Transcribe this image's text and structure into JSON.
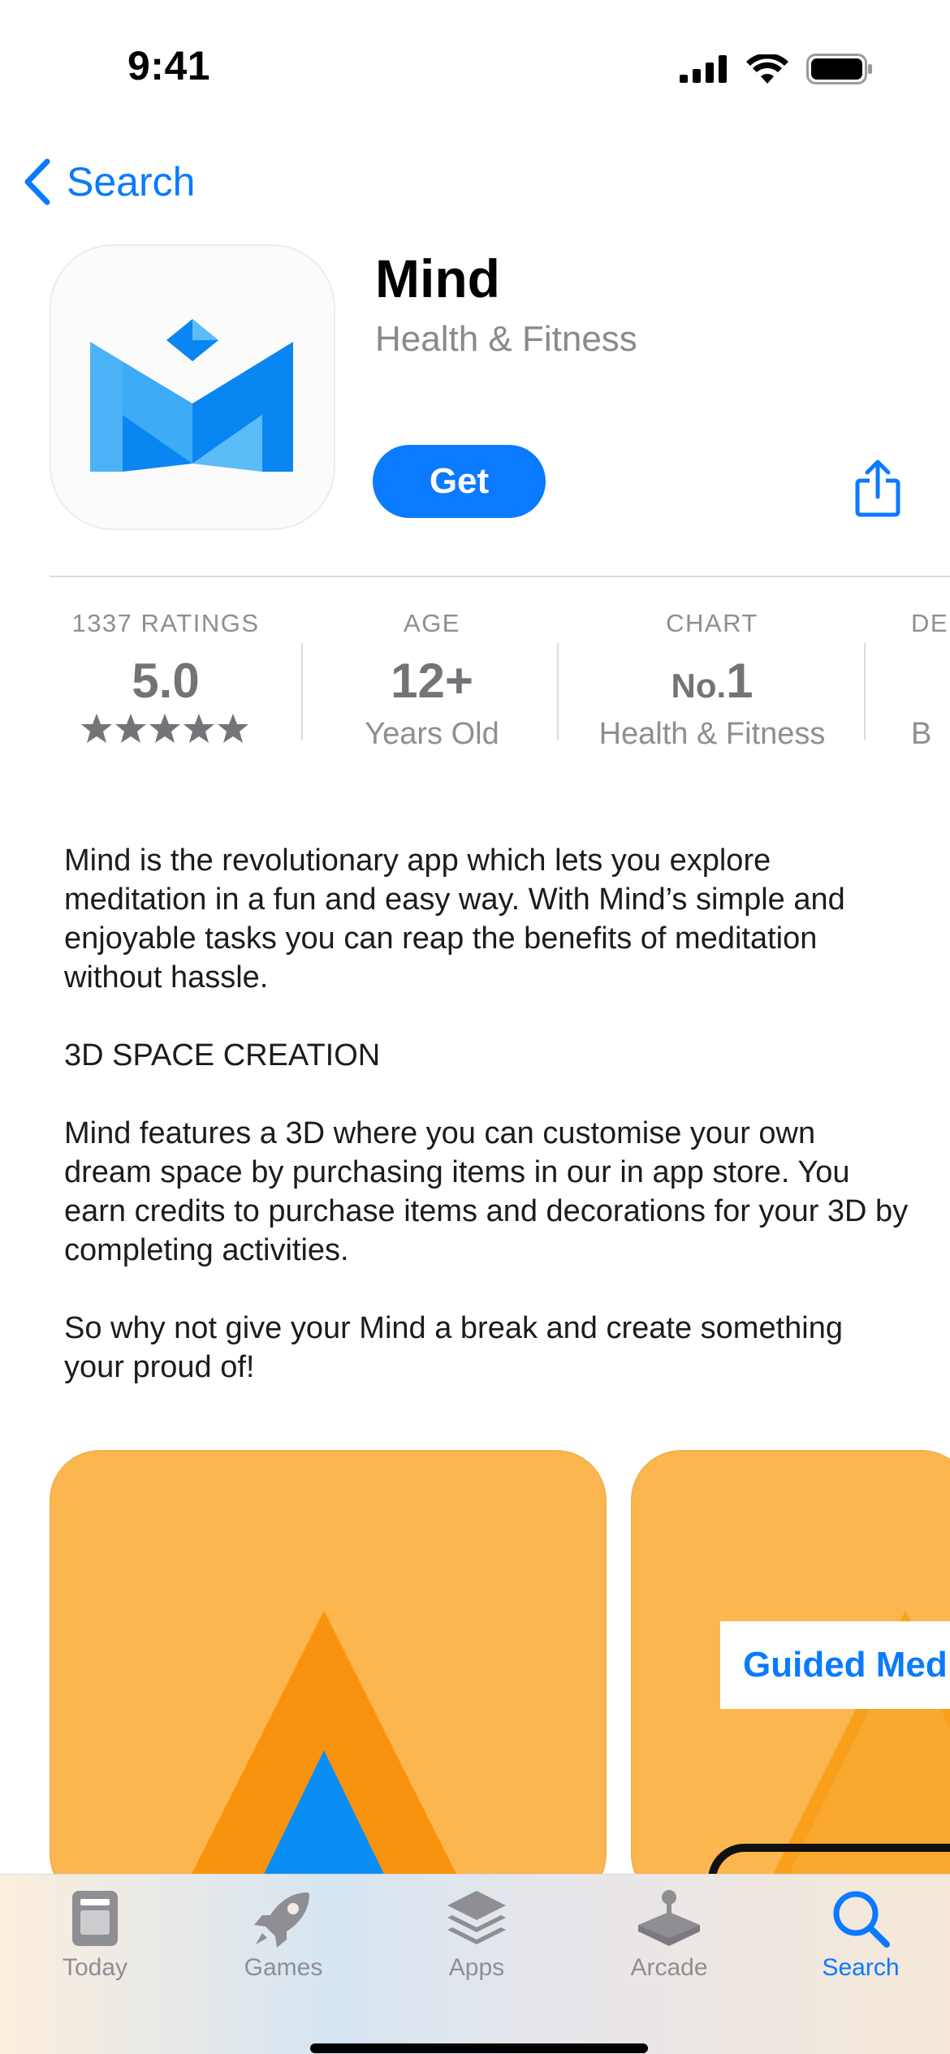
{
  "status_bar": {
    "time": "9:41"
  },
  "nav": {
    "back_label": "Search"
  },
  "app": {
    "name": "Mind",
    "category": "Health & Fitness",
    "get_label": "Get"
  },
  "info": {
    "ratings": {
      "label": "1337 RATINGS",
      "value": "5.0",
      "stars": 5
    },
    "age": {
      "label": "AGE",
      "value": "12+",
      "sub": "Years Old"
    },
    "chart": {
      "label": "CHART",
      "value_prefix": "No.",
      "value_number": "1",
      "sub": "Health & Fitness"
    },
    "developer": {
      "label": "DE",
      "sub": "B"
    }
  },
  "description": {
    "p1": "Mind is the revolutionary app which lets you explore meditation in a fun and easy way. With Mind’s simple and enjoyable tasks you can reap the benefits of meditation without hassle.",
    "p2": "3D SPACE CREATION",
    "p3": "Mind features a 3D where you can customise your own dream space by purchasing items in our in app store. You earn credits to purchase items and decorations for your 3D by completing activities.",
    "p4": "So why not give your Mind a break and create something your proud of!"
  },
  "screenshots": {
    "second_caption": "Guided Med"
  },
  "tabs": [
    {
      "label": "Today",
      "icon": "today-icon",
      "active": false
    },
    {
      "label": "Games",
      "icon": "rocket-icon",
      "active": false
    },
    {
      "label": "Apps",
      "icon": "layers-icon",
      "active": false
    },
    {
      "label": "Arcade",
      "icon": "joystick-icon",
      "active": false
    },
    {
      "label": "Search",
      "icon": "search-icon",
      "active": true
    }
  ],
  "colors": {
    "accent": "#0a7aff",
    "screenshot_bg": "#fbb650",
    "triangle": "#f7930c",
    "triangle_inner": "#0a8df5"
  }
}
